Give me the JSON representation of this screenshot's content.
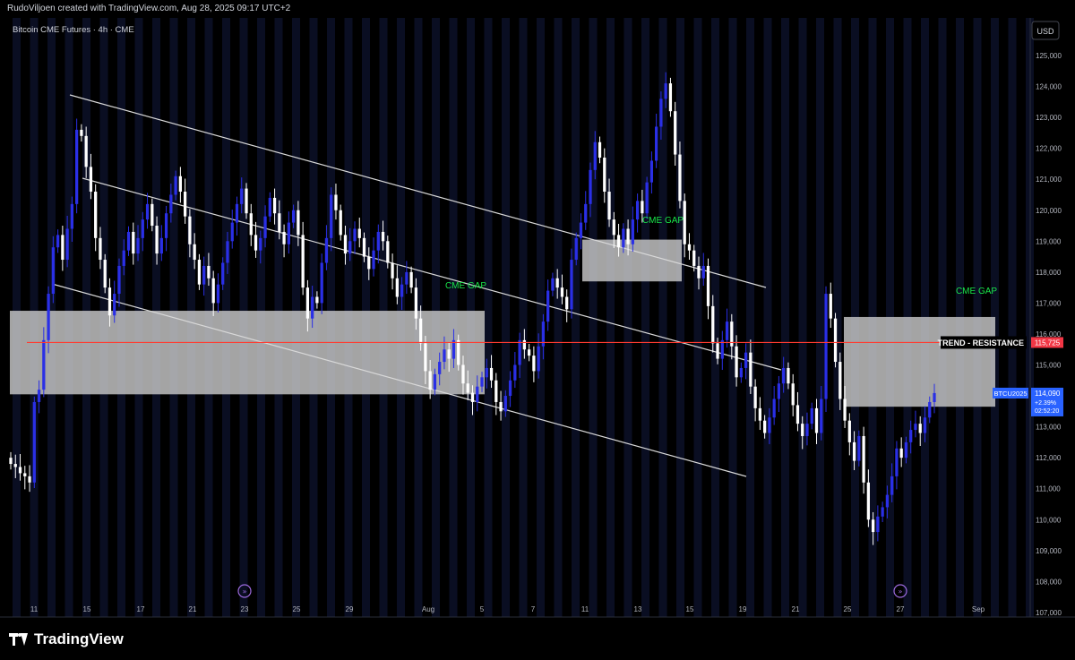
{
  "header": {
    "text": "RudoViljoen created with TradingView.com, Aug 28, 2025 09:17 UTC+2"
  },
  "brand": {
    "name": "TradingView"
  },
  "colors": {
    "background": "#000000",
    "bull": "#2a2fe6",
    "bear": "#ffffff",
    "resistance": "#ff3b30",
    "gap_label": "#19e64b",
    "gap_box": "#c8c8c8",
    "badge_blue": "#2962ff",
    "badge_red": "#f23645"
  },
  "chart_data": {
    "type": "candlestick",
    "title": "Bitcoin CME Futures · 4h · CME",
    "currency": "USD",
    "ylim": [
      106000,
      126000
    ],
    "y_ticks": [
      107000,
      108000,
      109000,
      110000,
      111000,
      112000,
      113000,
      114000,
      115000,
      116000,
      117000,
      118000,
      119000,
      120000,
      121000,
      122000,
      123000,
      124000,
      125000
    ],
    "x_ticks": [
      "11",
      "15",
      "17",
      "21",
      "23",
      "25",
      "29",
      "Aug",
      "5",
      "7",
      "11",
      "13",
      "15",
      "19",
      "21",
      "25",
      "27",
      "Sep"
    ],
    "resistance": {
      "label": "TREND - RESISTANCE",
      "value": 115725,
      "value_label": "115,725"
    },
    "last_price": {
      "symbol": "BTCU2025",
      "value": 114090,
      "value_label": "114,090",
      "change": "+2.39%",
      "countdown": "02:52:20"
    },
    "gaps": [
      {
        "label": "CME GAP",
        "from": 114050,
        "to": 116750
      },
      {
        "label": "CME GAP",
        "from": 117700,
        "to": 119050
      },
      {
        "label": "CME GAP",
        "from": 113650,
        "to": 116550
      }
    ],
    "closes": [
      111800,
      111700,
      111500,
      111400,
      111200,
      113800,
      114200,
      115800,
      117300,
      118800,
      119200,
      118400,
      119400,
      120200,
      122600,
      122400,
      121400,
      120600,
      119100,
      118400,
      117500,
      116600,
      117300,
      118200,
      118700,
      119300,
      118600,
      119100,
      119700,
      120200,
      119500,
      118600,
      119100,
      119900,
      120500,
      121100,
      120600,
      119800,
      118900,
      118400,
      117600,
      118200,
      117800,
      117000,
      117600,
      118300,
      119000,
      119600,
      120200,
      120700,
      119900,
      119200,
      118700,
      119100,
      119800,
      120400,
      119900,
      119300,
      118900,
      119600,
      120000,
      119200,
      117500,
      116500,
      117200,
      117000,
      118300,
      119100,
      120500,
      120000,
      119200,
      118600,
      119000,
      119400,
      119100,
      118500,
      118100,
      118700,
      119300,
      119000,
      118300,
      117800,
      117200,
      117600,
      118000,
      117500,
      116500,
      115700,
      114800,
      114200,
      114700,
      115100,
      115500,
      115200,
      115800,
      115000,
      114400,
      114100,
      113800,
      114300,
      114600,
      114900,
      114500,
      113800,
      113500,
      114000,
      114500,
      115000,
      115800,
      115500,
      115300,
      114800,
      115600,
      116400,
      117400,
      117800,
      117500,
      117200,
      116800,
      118400,
      119100,
      119600,
      120200,
      121300,
      122200,
      121700,
      120600,
      119700,
      119200,
      118800,
      119400,
      118900,
      119700,
      120300,
      119900,
      120900,
      121600,
      122700,
      123600,
      124100,
      123200,
      121800,
      120300,
      118900,
      118700,
      118200,
      117800,
      118200,
      116900,
      115700,
      115200,
      115800,
      116400,
      115600,
      114600,
      114900,
      115400,
      114300,
      113600,
      113200,
      112800,
      113300,
      113900,
      114400,
      114900,
      114400,
      113700,
      113100,
      112700,
      113100,
      113600,
      112800,
      113900,
      117300,
      116500,
      115100,
      113900,
      113200,
      112500,
      111900,
      112700,
      111200,
      110000,
      109600,
      110100,
      110400,
      110800,
      111400,
      112300,
      112000,
      112500,
      112900,
      113100,
      112800,
      113300,
      113800,
      114090
    ]
  }
}
